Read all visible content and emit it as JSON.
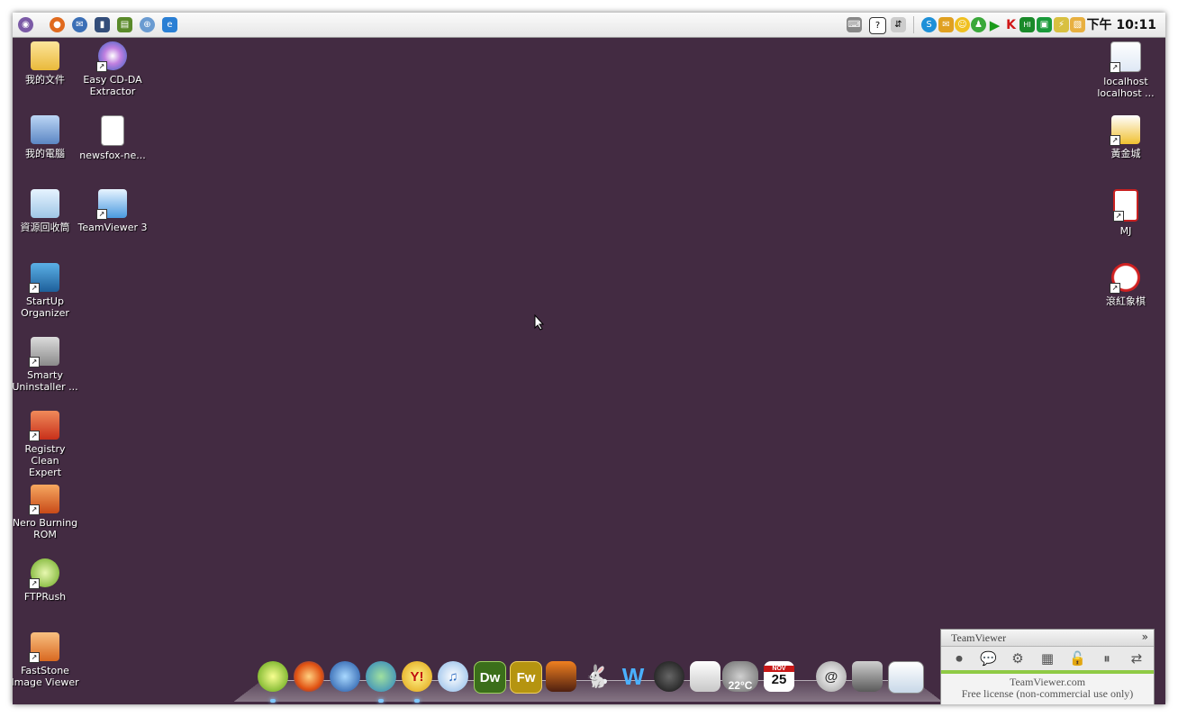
{
  "top_bar": {
    "clock": "下午 10:11",
    "launcher_icons": [
      "ubuntu-logo-icon",
      "firefox-icon",
      "thunderbird-icon",
      "bookmark-icon",
      "books-icon",
      "globe-icon",
      "browser-icon"
    ],
    "tray_icons": [
      "keyboard-icon",
      "help-icon",
      "usb-icon",
      "skype-icon",
      "mail-icon",
      "emoticon-icon",
      "user-status-icon",
      "play-icon",
      "k-icon",
      "hi-icon",
      "chat-icon",
      "network-icon",
      "notes-icon"
    ]
  },
  "desktop": {
    "background_color": "#432b42",
    "left_column_1": [
      {
        "id": "my-documents",
        "label": "我的文件"
      },
      {
        "id": "my-computer",
        "label": "我的電腦"
      },
      {
        "id": "recycle-bin",
        "label": "資源回收筒"
      },
      {
        "id": "startup-organizer",
        "label": "StartUp\nOrganizer"
      },
      {
        "id": "smarty-uninstaller",
        "label": "Smarty\nUninstaller ..."
      },
      {
        "id": "registry-clean-expert",
        "label": "Registry Clean\nExpert"
      },
      {
        "id": "nero-burning-rom",
        "label": "Nero Burning\nROM"
      },
      {
        "id": "ftprush",
        "label": "FTPRush"
      },
      {
        "id": "faststone-image-viewer",
        "label": "FastStone\nImage Viewer"
      }
    ],
    "left_column_2": [
      {
        "id": "easy-cd-da-extractor",
        "label": "Easy CD-DA\nExtractor"
      },
      {
        "id": "newsfox",
        "label": "newsfox-ne..."
      },
      {
        "id": "teamviewer-3",
        "label": "TeamViewer 3"
      }
    ],
    "right_column": [
      {
        "id": "localhost",
        "label": "localhost\nlocalhost ..."
      },
      {
        "id": "golden-city",
        "label": "黃金城"
      },
      {
        "id": "mj",
        "label": "MJ"
      },
      {
        "id": "chinese-chess",
        "label": "滾紅象棋"
      }
    ]
  },
  "dock": {
    "items": [
      "media-player-icon",
      "firefox-icon",
      "globe-icon",
      "messenger-icon",
      "yahoo-messenger-icon",
      "itunes-icon",
      "dreamweaver-icon",
      "fireworks-icon",
      "photo-icon",
      "rabbit-icon",
      "word-icon",
      "speed-icon",
      "recycle-bag-icon",
      "weather-icon",
      "calendar-icon",
      "at-icon",
      "trash-icon",
      "screen-icon"
    ],
    "dw_label": "Dw",
    "fw_label": "Fw",
    "weather_temp": "22°C",
    "calendar_day": "25",
    "calendar_month": "NOV"
  },
  "teamviewer_panel": {
    "title": "TeamViewer",
    "site": "TeamViewer.com",
    "license": "Free license (non-commercial use only)"
  }
}
